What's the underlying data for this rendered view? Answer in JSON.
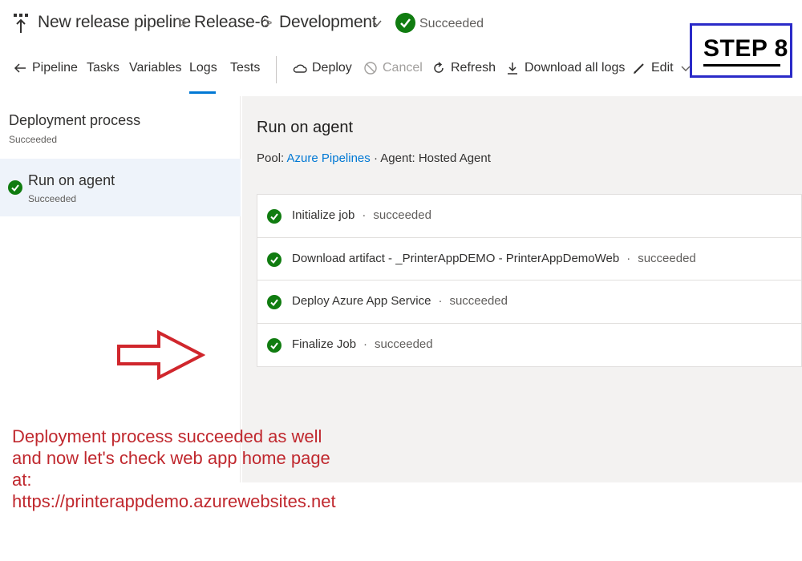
{
  "header": {
    "pipeline_name": "New release pipeline",
    "release_name": "Release-6",
    "stage_name": "Development",
    "status": "Succeeded",
    "separator": ">"
  },
  "toolbar": {
    "items": [
      {
        "label": "Pipeline",
        "icon": "arrow-left-icon"
      },
      {
        "label": "Tasks"
      },
      {
        "label": "Variables"
      },
      {
        "label": "Logs",
        "selected": true
      },
      {
        "label": "Tests"
      },
      {
        "label": "Deploy",
        "icon": "cloud-icon"
      },
      {
        "label": "Cancel",
        "icon": "cancel-icon",
        "disabled": true
      },
      {
        "label": "Refresh",
        "icon": "refresh-icon"
      },
      {
        "label": "Download all logs",
        "icon": "download-icon"
      },
      {
        "label": "Edit",
        "icon": "pencil-icon"
      }
    ],
    "more": "..."
  },
  "step_badge": {
    "label": "STEP 8"
  },
  "left_panel": {
    "title": "Deployment process",
    "status": "Succeeded",
    "job": {
      "title": "Run on agent",
      "status": "Succeeded"
    }
  },
  "right_panel": {
    "title": "Run on agent",
    "pool_label": "Pool:",
    "pool_link": "Azure Pipelines",
    "agent_text": "· Agent: Hosted Agent",
    "dot": "·",
    "steps": [
      {
        "name": "Initialize job",
        "state": "succeeded"
      },
      {
        "name": "Download artifact - _PrinterAppDEMO - PrinterAppDemoWeb",
        "state": "succeeded"
      },
      {
        "name": "Deploy Azure App Service",
        "state": "succeeded"
      },
      {
        "name": "Finalize Job",
        "state": "succeeded"
      }
    ]
  },
  "annotation": {
    "text": "Deployment process succeeded as well\nand now let's check web app home page\nat:\nhttps://printerappdemo.azurewebsites.net"
  },
  "colors": {
    "success": "#107c10",
    "link": "#0078d4",
    "annotation": "#c0282e",
    "badge_border": "#2a2ac8"
  }
}
